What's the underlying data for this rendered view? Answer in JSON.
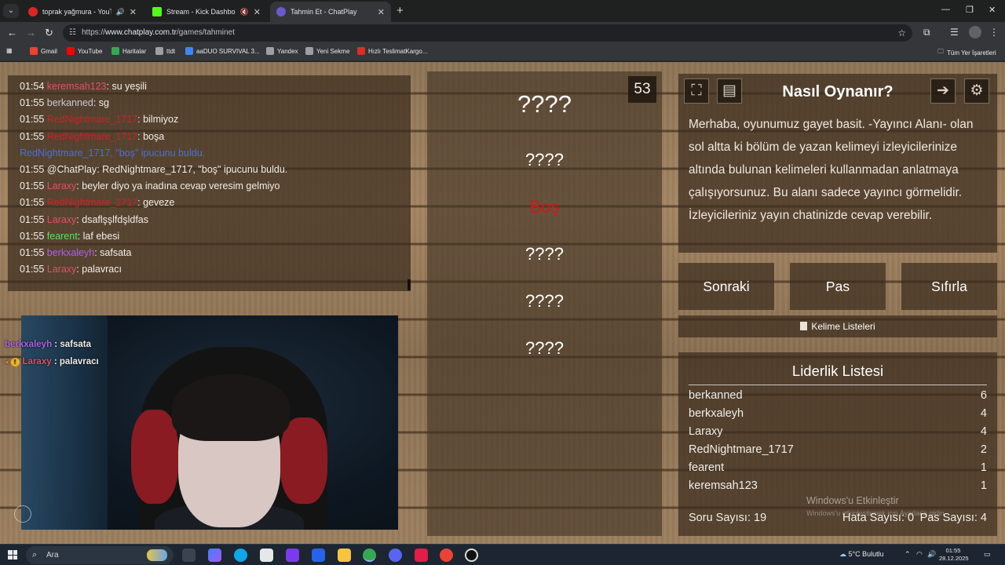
{
  "browser": {
    "tabs": [
      {
        "title": "toprak yağmura - YouTube",
        "favicon_color": "#e02424"
      },
      {
        "title": "Stream - Kick Dashboard",
        "favicon_color": "#53fc18"
      },
      {
        "title": "Tahmin Et - ChatPlay",
        "favicon_color": "#6a5acd"
      }
    ],
    "url_prefix": "https://",
    "url_host": "www.chatplay.com.tr",
    "url_path": "/games/tahminet",
    "bookmarks": [
      {
        "label": "Gmail",
        "color": "#ea4335"
      },
      {
        "label": "YouTube",
        "color": "#ff0000"
      },
      {
        "label": "Haritalar",
        "color": "#34a853"
      },
      {
        "label": "ttdt",
        "color": "#9aa0a6"
      },
      {
        "label": "aaDUO SURVIVAL 3...",
        "color": "#4285f4"
      },
      {
        "label": "Yandex",
        "color": "#9aa0a6"
      },
      {
        "label": "Yeni Sekme",
        "color": "#9aa0a6"
      },
      {
        "label": "Hızlı TeslimatKargo...",
        "color": "#d93025"
      }
    ],
    "all_bookmarks": "Tüm Yer İşaretleri"
  },
  "chat": {
    "lines": [
      {
        "time": "01:54",
        "nick": "keremsah123",
        "nick_color": "#e0506a",
        "sep": ": ",
        "msg": "su yeşili"
      },
      {
        "time": "01:55",
        "nick": "berkanned",
        "nick_color": "#c8c8d8",
        "sep": ": ",
        "msg": "sg"
      },
      {
        "time": "01:55",
        "nick": "RedNightmare_1717",
        "nick_color": "#d0202a",
        "sep": ": ",
        "msg": "bilmiyoz"
      },
      {
        "time": "01:55",
        "nick": "RedNightmare_1717",
        "nick_color": "#d0202a",
        "sep": ": ",
        "msg": "boşa"
      },
      {
        "time": "",
        "nick": "RedNightmare_1717, \"boş\" ipucunu buldu.",
        "nick_color": "#4a6ee0",
        "sep": "",
        "msg": ""
      },
      {
        "time": "01:55",
        "nick": "@ChatPlay",
        "nick_color": "#f1eee9",
        "sep": ": ",
        "msg": "RedNightmare_1717, \"boş\" ipucunu buldu."
      },
      {
        "time": "01:55",
        "nick": "Laraxy",
        "nick_color": "#e0506a",
        "sep": ": ",
        "msg": "beyler diyo ya inadına cevap veresim gelmiyo"
      },
      {
        "time": "01:55",
        "nick": "RedNightmare_1717",
        "nick_color": "#d0202a",
        "sep": ": ",
        "msg": "geveze"
      },
      {
        "time": "01:55",
        "nick": "Laraxy",
        "nick_color": "#e0506a",
        "sep": ": ",
        "msg": "dsaflşşlfdşldfas"
      },
      {
        "time": "01:55",
        "nick": "fearent",
        "nick_color": "#5ee05e",
        "sep": ": ",
        "msg": "laf ebesi"
      },
      {
        "time": "01:55",
        "nick": "berkxaleyh",
        "nick_color": "#b060e8",
        "sep": ": ",
        "msg": "safsata"
      },
      {
        "time": "01:55",
        "nick": "Laraxy",
        "nick_color": "#e0506a",
        "sep": ": ",
        "msg": "palavracı"
      }
    ]
  },
  "stream_overlay": {
    "messages": [
      {
        "nick": "berkxaleyh",
        "nick_color": "#b060e8",
        "msg": " : safsata",
        "badge": ""
      },
      {
        "nick": "Laraxy",
        "nick_color": "#e0506a",
        "msg": " : palavracı",
        "badge": "!"
      }
    ]
  },
  "game": {
    "timer": "53",
    "main_word": "????",
    "taboo_words": [
      "????",
      "Boş",
      "????",
      "????",
      "????"
    ]
  },
  "howto": {
    "title": "Nasıl Oynanır?",
    "text": "Merhaba, oyunumuz gayet basit. -Yayıncı Alanı- olan sol altta ki bölüm de yazan kelimeyi izleyicilerinize altında bulunan kelimeleri kullanmadan anlatmaya çalışıyorsunuz. Bu alanı sadece yayıncı görmelidir. İzleyicileriniz yayın chatinizde cevap verebilir."
  },
  "actions": {
    "next": "Sonraki",
    "pass": "Pas",
    "reset": "Sıfırla",
    "word_lists": "Kelime Listeleri"
  },
  "leaderboard": {
    "title": "Liderlik Listesi",
    "rows": [
      {
        "name": "berkanned",
        "score": "6"
      },
      {
        "name": "berkxaleyh",
        "score": "4"
      },
      {
        "name": "Laraxy",
        "score": "4"
      },
      {
        "name": "RedNightmare_1717",
        "score": "2"
      },
      {
        "name": "fearent",
        "score": "1"
      },
      {
        "name": "keremsah123",
        "score": "1"
      }
    ],
    "questions": "Soru Sayısı: 19",
    "errors": "Hata Sayısı: 0",
    "passes": "Pas Sayısı: 4"
  },
  "watermark": {
    "line1": "Windows'u Etkinleştir",
    "line2": "Windows'u etkinleştirmek için Ayarlar'a gidin."
  },
  "taskbar": {
    "search_placeholder": "Ara",
    "weather": "5°C  Bulutlu",
    "time": "01:55",
    "date": "28.12.2025"
  }
}
